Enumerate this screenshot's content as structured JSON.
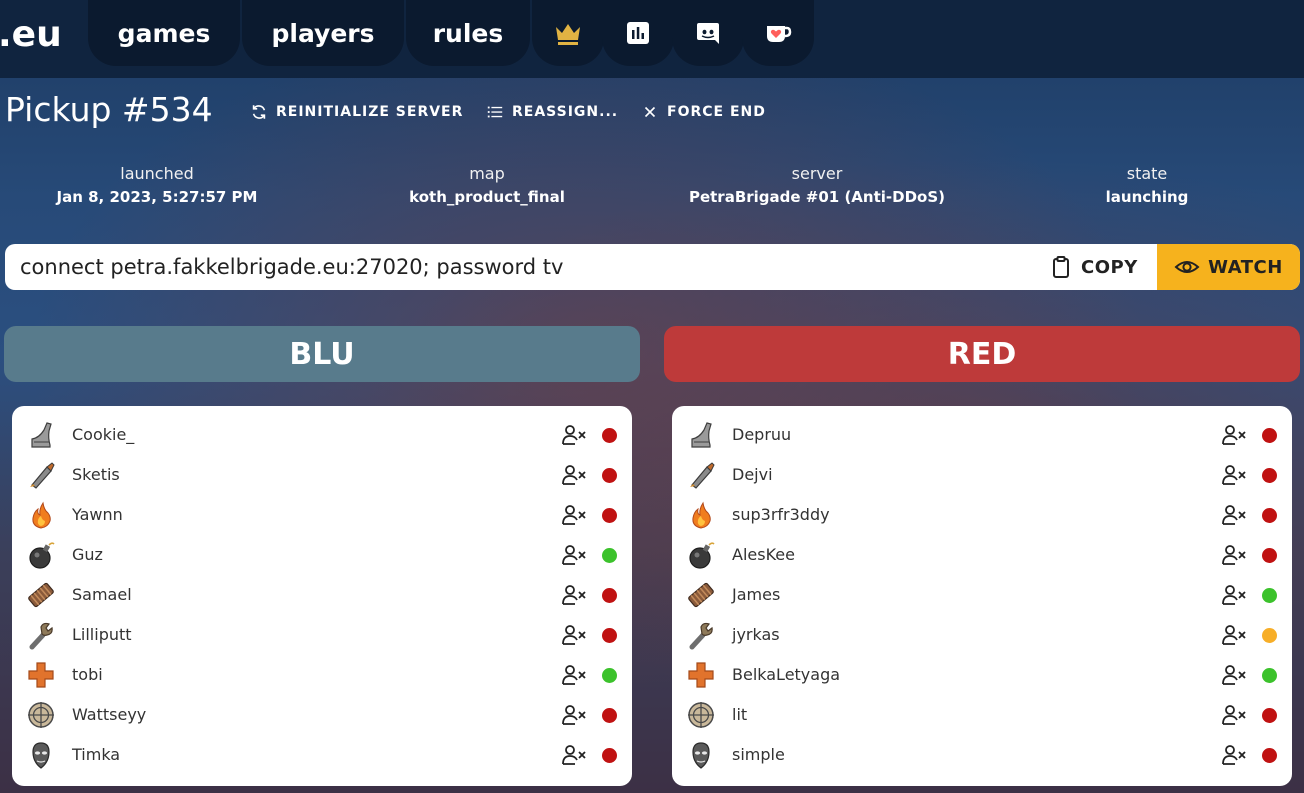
{
  "nav": {
    "brand": ".eu",
    "links": [
      "games",
      "players",
      "rules"
    ],
    "icons": [
      "crown-icon",
      "stats-icon",
      "discord-icon",
      "kofi-icon"
    ]
  },
  "header": {
    "title": "Pickup #534",
    "actions": [
      "REINITIALIZE SERVER",
      "REASSIGN...",
      "FORCE END"
    ]
  },
  "info": {
    "launched": {
      "label": "launched",
      "value": "Jan 8, 2023, 5:27:57 PM"
    },
    "map": {
      "label": "map",
      "value": "koth_product_final"
    },
    "server": {
      "label": "server",
      "value": "PetraBrigade #01 (Anti-DDoS)"
    },
    "state": {
      "label": "state",
      "value": "launching"
    }
  },
  "connect": {
    "command": "connect petra.fakkelbrigade.eu:27020; password tv",
    "copy_label": "COPY",
    "watch_label": "WATCH"
  },
  "colors": {
    "blu": "#587b8c",
    "red": "#be3a3a",
    "accent": "#f6b21d",
    "status_online": "#3cc22c",
    "status_offline": "#c01212",
    "status_away": "#f7ae28"
  },
  "teams": {
    "blu": {
      "name": "BLU",
      "players": [
        {
          "name": "Cookie_",
          "class": "scout",
          "status": "offline"
        },
        {
          "name": "Sketis",
          "class": "soldier",
          "status": "offline"
        },
        {
          "name": "Yawnn",
          "class": "pyro",
          "status": "offline"
        },
        {
          "name": "Guz",
          "class": "demoman",
          "status": "online"
        },
        {
          "name": "Samael",
          "class": "heavy",
          "status": "offline"
        },
        {
          "name": "Lilliputt",
          "class": "engineer",
          "status": "offline"
        },
        {
          "name": "tobi",
          "class": "medic",
          "status": "online"
        },
        {
          "name": "Wattseyy",
          "class": "sniper",
          "status": "offline"
        },
        {
          "name": "Timka",
          "class": "spy",
          "status": "offline"
        }
      ]
    },
    "red": {
      "name": "RED",
      "players": [
        {
          "name": "Depruu",
          "class": "scout",
          "status": "offline"
        },
        {
          "name": "Dejvi",
          "class": "soldier",
          "status": "offline"
        },
        {
          "name": "sup3rfr3ddy",
          "class": "pyro",
          "status": "offline"
        },
        {
          "name": "AlesKee",
          "class": "demoman",
          "status": "offline"
        },
        {
          "name": "James",
          "class": "heavy",
          "status": "online"
        },
        {
          "name": "jyrkas",
          "class": "engineer",
          "status": "away"
        },
        {
          "name": "BelkaLetyaga",
          "class": "medic",
          "status": "online"
        },
        {
          "name": "lit",
          "class": "sniper",
          "status": "offline"
        },
        {
          "name": "simple",
          "class": "spy",
          "status": "offline"
        }
      ]
    }
  }
}
